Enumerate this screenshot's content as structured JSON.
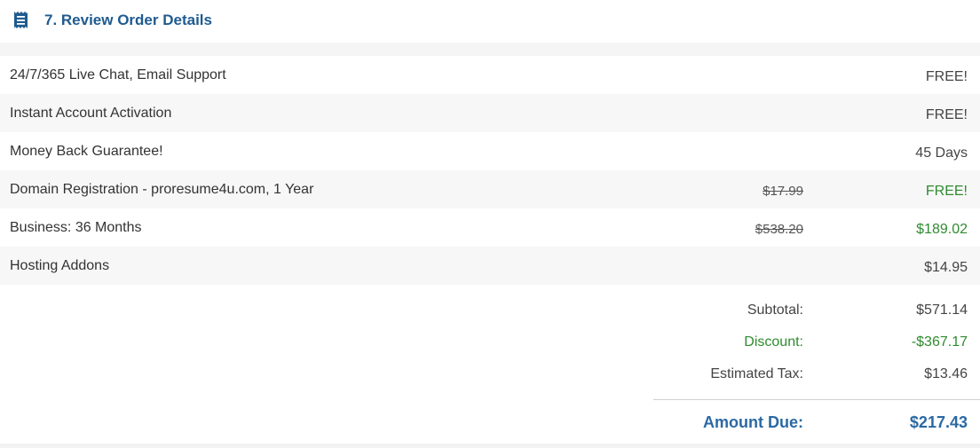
{
  "section": {
    "title": "7. Review Order Details",
    "icon": "receipt-icon",
    "accent_color": "#1f5b8f"
  },
  "items": [
    {
      "label": "24/7/365 Live Chat, Email Support",
      "original_price": "",
      "price": "FREE!",
      "highlight": false
    },
    {
      "label": "Instant Account Activation",
      "original_price": "",
      "price": "FREE!",
      "highlight": false
    },
    {
      "label": "Money Back Guarantee!",
      "original_price": "",
      "price": "45 Days",
      "highlight": false
    },
    {
      "label": "Domain Registration - proresume4u.com, 1 Year",
      "original_price": "$17.99",
      "price": "FREE!",
      "highlight": true
    },
    {
      "label": "Business: 36 Months",
      "original_price": "$538.20",
      "price": "$189.02",
      "highlight": true
    },
    {
      "label": "Hosting Addons",
      "original_price": "",
      "price": "$14.95",
      "highlight": false
    }
  ],
  "totals": {
    "subtotal_label": "Subtotal:",
    "subtotal_value": "$571.14",
    "discount_label": "Discount:",
    "discount_value": "-$367.17",
    "tax_label": "Estimated Tax:",
    "tax_value": "$13.46",
    "amount_due_label": "Amount Due:",
    "amount_due_value": "$217.43"
  },
  "colors": {
    "discount_green": "#2e8b2e",
    "amount_due_blue": "#2a69a3"
  }
}
